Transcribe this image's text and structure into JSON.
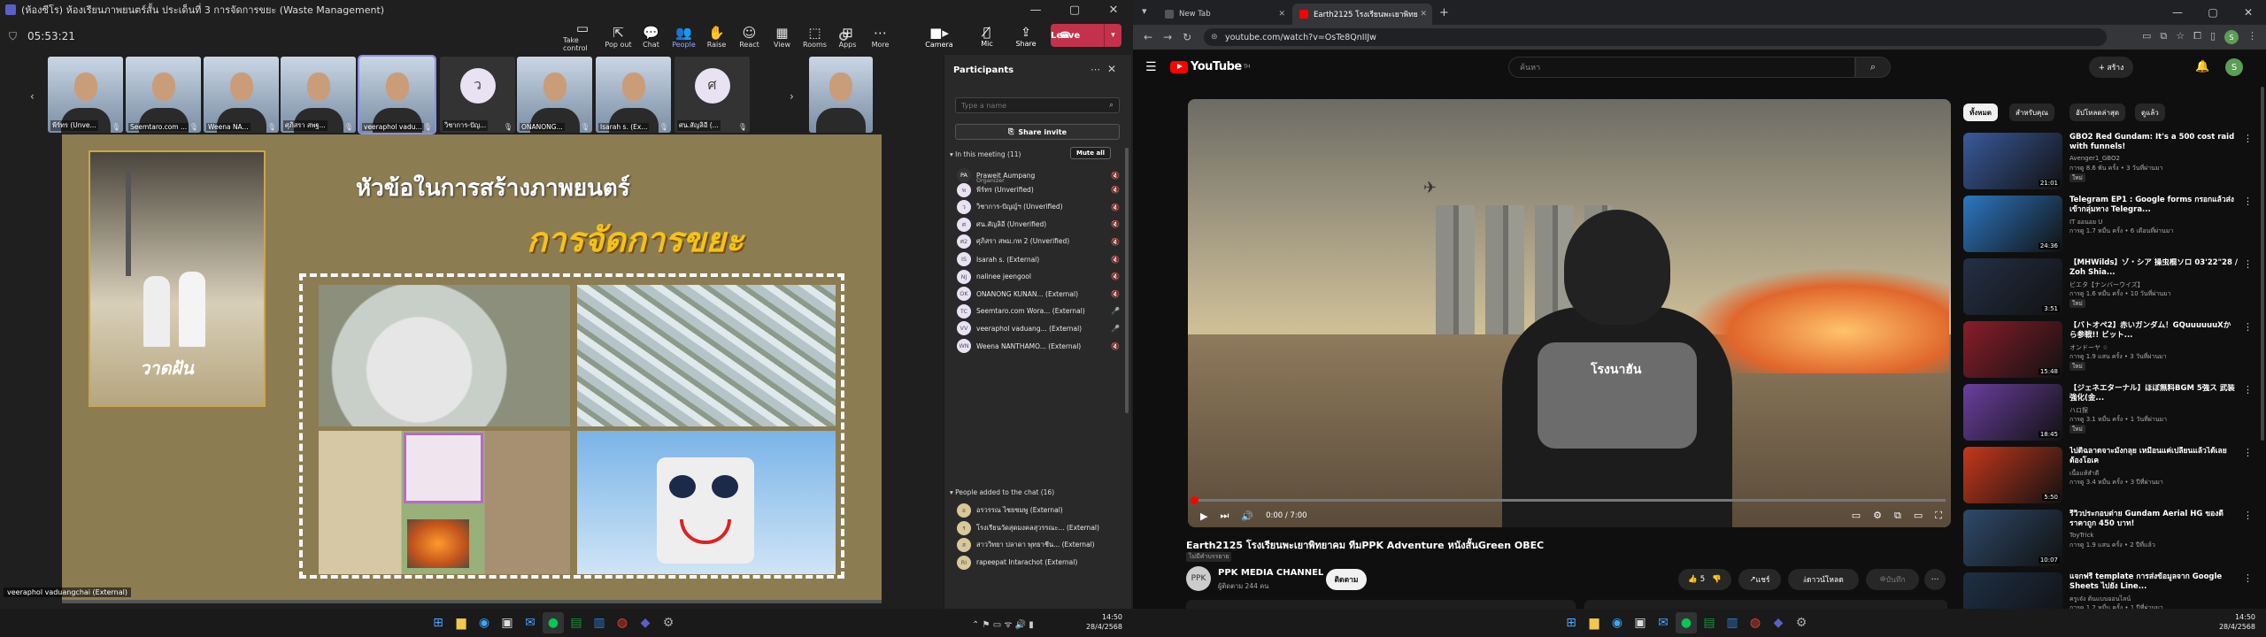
{
  "teams": {
    "window_title": "(ห้องซีโร) ห้องเรียนภาพยนตร์สั้น ประเด็นที่ 3 การจัดการขยะ (Waste Management)",
    "call_time": "05:53:21",
    "toolbar": [
      {
        "icon": "▭",
        "label": "Take control"
      },
      {
        "icon": "⇱",
        "label": "Pop out"
      },
      {
        "icon": "💬",
        "label": "Chat"
      },
      {
        "icon": "👥",
        "label": "People"
      },
      {
        "icon": "✋",
        "label": "Raise"
      },
      {
        "icon": "☺",
        "label": "React"
      },
      {
        "icon": "▦",
        "label": "View"
      },
      {
        "icon": "⬚",
        "label": "Rooms"
      },
      {
        "icon": "⊞",
        "label": "Apps"
      },
      {
        "icon": "⋯",
        "label": "More"
      }
    ],
    "camera_label": "Camera",
    "mic_label": "Mic",
    "share_label": "Share",
    "leave_label": "Leave",
    "gallery": [
      {
        "name": "พีร์ทร (Unve...",
        "type": "video",
        "selected": false
      },
      {
        "name": "Seemtaro.com ...",
        "type": "video",
        "selected": false
      },
      {
        "name": "Weena NA...",
        "type": "video",
        "selected": false
      },
      {
        "name": "ศุภิสรา สพฐ...",
        "type": "video",
        "selected": false
      },
      {
        "name": "veeraphol vadu...",
        "type": "video",
        "selected": true
      },
      {
        "name": "วิชาการ-ปัญ...",
        "type": "avatar",
        "initial": "ว",
        "selected": false
      },
      {
        "name": "ONANONG...",
        "type": "video",
        "selected": false
      },
      {
        "name": "Isarah s. (Ex...",
        "type": "video",
        "selected": false
      },
      {
        "name": "ศน.สัญลิอี (...",
        "type": "avatar",
        "initial": "ศ",
        "selected": false
      },
      {
        "name": "",
        "type": "video",
        "selected": false
      }
    ],
    "slide": {
      "title": "หัวข้อในการสร้างภาพยนตร์",
      "subtitle": "การจัดการขยะ",
      "poster_title": "วาดฝัน"
    },
    "shared_owner": "veeraphol vaduangchai (External)",
    "participants": {
      "title": "Participants",
      "search_placeholder": "Type a name",
      "share_invite": "Share invite",
      "in_meeting_label": "In this meeting (11)",
      "mute_all": "Mute all",
      "in_meeting": [
        {
          "initials": "PA",
          "name": "Praweit Aumpang",
          "role": "Organizer",
          "mic": "🔇"
        },
        {
          "initials": "พ",
          "name": "พีร์ทร (Unverified)",
          "role": "",
          "mic": "🔇"
        },
        {
          "initials": "ว",
          "name": "วิชาการ-ปัญญ์ฯ (Unverified)",
          "role": "",
          "mic": "🔇"
        },
        {
          "initials": "ศ",
          "name": "ศน.สัญลิอี (Unverified)",
          "role": "",
          "mic": "🔇"
        },
        {
          "initials": "ศ2",
          "name": "ศุภิสรา สพม.กท 2 (Unverified)",
          "role": "",
          "mic": "🔇"
        },
        {
          "initials": "IS",
          "name": "Isarah s. (External)",
          "role": "",
          "mic": "🔇"
        },
        {
          "initials": "NJ",
          "name": "nalinee jeengool",
          "role": "",
          "mic": "🔇"
        },
        {
          "initials": "OK",
          "name": "ONANONG KUNAN... (External)",
          "role": "",
          "mic": "🔇"
        },
        {
          "initials": "TC",
          "name": "Seemtaro.com Wora... (External)",
          "role": "",
          "mic": "🎤"
        },
        {
          "initials": "VV",
          "name": "veeraphol vaduang... (External)",
          "role": "",
          "mic": "🎤"
        },
        {
          "initials": "WN",
          "name": "Weena NANTHAMO... (External)",
          "role": "",
          "mic": "🔇"
        }
      ],
      "chat_label": "People added to the chat (16)",
      "chat_people": [
        {
          "initials": "อ",
          "name": "อรวรรณ ไชยชมพู (External)"
        },
        {
          "initials": "ร",
          "name": "โรงเรียนวัดสุดมงคลสุวรรณะ... (External)"
        },
        {
          "initials": "ส",
          "name": "สาววิทยา ปลาดา พุทธาชีน... (External)"
        },
        {
          "initials": "RI",
          "name": "rapeepat Intarachot (External)"
        }
      ]
    }
  },
  "browser": {
    "tabs": [
      {
        "title": "New Tab",
        "active": false
      },
      {
        "title": "Earth2125 โรงเรียนพะเยาพิทยาคม...",
        "active": true
      }
    ],
    "url": "youtube.com/watch?v=OsTe8QnIIJw",
    "profile_initial": "S",
    "youtube": {
      "search_placeholder": "ค้นหา",
      "create_label": "+ สร้าง",
      "avatar_initial": "S",
      "region": "TH",
      "time_display": "0:00 / 7:00",
      "progress": 0,
      "video_title": "Earth2125 โรงเรียนพะเยาพิทยาคม ทีมPPK Adventure หนังสั้นGreen OBEC",
      "video_subtitle": "ไม่มีคำบรรยาย",
      "channel": "PPK MEDIA CHANNEL",
      "channel_initial": "PPK",
      "subscribers": "ผู้ติดตาม 244 คน",
      "subscribe_label": "ติดตาม",
      "likes": "5",
      "share_label": "แชร์",
      "download_label": "ดาวน์โหลด",
      "save_label": "บันทึก",
      "vest_text": "โรงนาฮัน",
      "chips": [
        {
          "label": "ทั้งหมด",
          "on": true
        },
        {
          "label": "สำหรับคุณ",
          "on": false
        },
        {
          "label": "อัปโหลดล่าสุด",
          "on": false
        },
        {
          "label": "ดูแล้ว",
          "on": false
        }
      ],
      "recommendations": [
        {
          "title": "GBO2 Red Gundam: It's a 500 cost raid with funnels!",
          "channel": "Avenger1_GBO2",
          "meta": "การดู 8.6 พัน ครั้ง • 3 วันที่ผ่านมา",
          "badge": "ใหม่",
          "duration": "21:01",
          "color": "#3a5a9c"
        },
        {
          "title": "Telegram EP1 : Google forms กรอกแล้วส่งเข้ากลุ่มทาง Telegra...",
          "channel": "IT ออนอย U",
          "meta": "การดู 1.7 หมื่น ครั้ง • 6 เดือนที่ผ่านมา",
          "badge": "",
          "duration": "24:36",
          "color": "#2d77c2"
        },
        {
          "title": "【MHWilds】ゾ・シア 操虫棍ソロ 03'22\"28 / Zoh Shia...",
          "channel": "ビエタ【ナンバーウイズ】",
          "meta": "การดู 1.6 หมื่น ครั้ง • 10 วันที่ผ่านมา",
          "badge": "ใหม่",
          "duration": "3:51",
          "color": "#243046"
        },
        {
          "title": "【バトオペ2】赤いガンダム！GQuuuuuuXから参戦!! ビット...",
          "channel": "オンドーヤ ☆",
          "meta": "การดู 1.9 แสน ครั้ง • 3 วันที่ผ่านมา",
          "badge": "ใหม่",
          "duration": "15:48",
          "color": "#8a1d2a"
        },
        {
          "title": "【ジェネエターナル】ほぼ無料BGM 5強ス 武装強化(金...",
          "channel": "ハロ探",
          "meta": "การดู 3.1 หมื่น ครั้ง • 1 วันที่ผ่านมา",
          "badge": "ใหม่",
          "duration": "18:45",
          "color": "#6b3fa0"
        },
        {
          "title": "ไปดิฉลาดจาะมังกลุย เหมือนแค่เปลี่ยนแล้วได้เลยต้องโอเค",
          "channel": "เนื้อแท้สำดี",
          "meta": "การดู 3.4 หมื่น ครั้ง • 3 ปีที่ผ่านมา",
          "badge": "",
          "duration": "5:50",
          "color": "#c7371c"
        },
        {
          "title": "รีวิวประกอบต่าย Gundam Aerial HG ของดีราคาถูก 450 บาท!",
          "channel": "ToyTrick",
          "meta": "การดู 1.9 แสน ครั้ง • 2 ปีที่แล้ว",
          "badge": "",
          "duration": "10:07",
          "color": "#2e4a6a"
        },
        {
          "title": "แจกฟรี template การส่งข้อมูลจาก Google Sheets ไปยัง Line...",
          "channel": "ครูเจ๋ง ต้นแบบออนไลน์",
          "meta": "การดู 1.2 หมื่น ครั้ง • 1 ปีที่ผ่านมา",
          "badge": "",
          "duration": "",
          "color": "#1e2f45"
        }
      ]
    }
  },
  "taskbar": {
    "left_time": "14:50",
    "left_date": "28/4/2568",
    "right_time": "14:50",
    "right_date": "28/4/2568"
  }
}
